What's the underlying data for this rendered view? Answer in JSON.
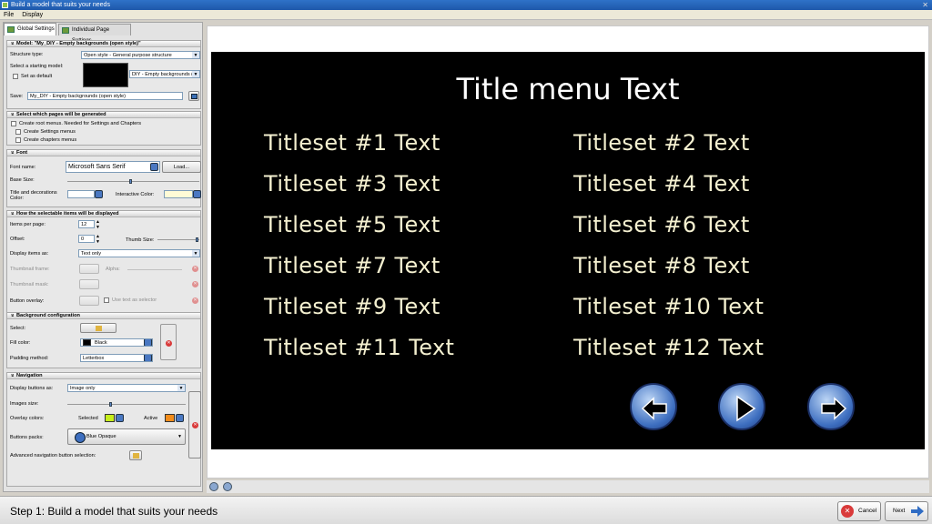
{
  "window": {
    "title": "Build a model that suits your needs"
  },
  "menu": [
    "File",
    "Display"
  ],
  "tabs": [
    "Global Settings",
    "Individual Page Settings"
  ],
  "model": {
    "header": "Model: \"My_DIY - Empty backgrounds (open style)\"",
    "structure_label": "Structure type:",
    "structure_value": "Open style - General purpose structure",
    "starting_label": "Select a starting model:",
    "starting_value": "DIY - Empty backgrounds (",
    "default_label": "Set as default",
    "save_label": "Save:",
    "save_value": "My_DIY - Empty backgrounds (open style)"
  },
  "pages": {
    "header": "Select which pages will be generated",
    "root": "Create root menus. Needed for Settings and Chapters",
    "settings": "Create Settings menus",
    "chapters": "Create chapters menus"
  },
  "font": {
    "header": "Font",
    "name_label": "Font name:",
    "name_value": "Microsoft Sans Serif",
    "load": "Load...",
    "size_label": "Base Size:",
    "title_color_label": "Title and decorations Color:",
    "interactive_label": "Interactive Color:"
  },
  "items": {
    "header": "How the selectable items will be displayed",
    "per_page_label": "Items per page:",
    "per_page": "12",
    "offset_label": "Offset:",
    "offset": "0",
    "thumb_size": "Thumb Size:",
    "display_label": "Display items as:",
    "display_value": "Text only",
    "frame": "Thumbnail frame:",
    "alpha": "Alpha:",
    "mask": "Thumbnail mask:",
    "overlay": "Button overlay:",
    "use_text": "Use text as selector"
  },
  "background": {
    "header": "Background configuration",
    "select": "Select:",
    "fill_label": "Fill color:",
    "fill_value": "Black",
    "padding_label": "Padding method:",
    "padding_value": "Letterbox"
  },
  "navigation": {
    "header": "Navigation",
    "display_label": "Display buttons as:",
    "display_value": "Image only",
    "size_label": "Images size:",
    "overlay_label": "Overlay colors:",
    "selected": "Selected",
    "active": "Active",
    "packs_label": "Buttons packs:",
    "packs_value": "Blue Opaque",
    "advanced": "Advanced navigation button selection:"
  },
  "preview": {
    "title": "Title menu Text",
    "titlesets": [
      "Titleset #1 Text",
      "Titleset #2 Text",
      "Titleset #3 Text",
      "Titleset #4 Text",
      "Titleset #5 Text",
      "Titleset #6 Text",
      "Titleset #7 Text",
      "Titleset #8 Text",
      "Titleset #9 Text",
      "Titleset #10 Text",
      "Titleset #11 Text",
      "Titleset #12 Text"
    ]
  },
  "footer": {
    "step": "Step 1: Build a model that suits your needs",
    "cancel": "Cancel",
    "next": "Next"
  },
  "colors": {
    "accent": "#2f72c8",
    "selected": "#c6ee1a",
    "active": "#f28c1a"
  }
}
